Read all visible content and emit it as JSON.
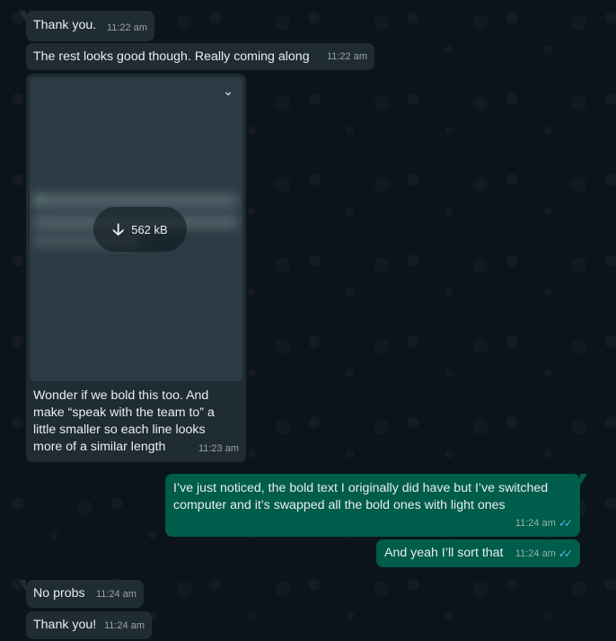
{
  "messages": [
    {
      "text": "Thank you.",
      "time": "11:22 am"
    },
    {
      "text": "The rest looks good though. Really coming along",
      "time": "11:22 am"
    },
    {
      "size": "562 kB",
      "caption": "Wonder if we bold this too. And make “speak with the team to” a little smaller so each line looks more of a similar length",
      "time": "11:23 am"
    },
    {
      "text": "I’ve just noticed, the bold text I originally did have but I’ve switched computer and it’s swapped all the bold ones with light ones",
      "time": "11:24 am"
    },
    {
      "text": "And yeah I’ll sort that",
      "time": "11:24 am"
    },
    {
      "text": "No probs",
      "time": "11:24 am"
    },
    {
      "text": "Thank you!",
      "time": "11:24 am"
    }
  ],
  "icons": {
    "download": "download-arrow-icon",
    "chevron": "chevron-down-icon",
    "read_receipt": "double-check-icon"
  },
  "colors": {
    "incoming_bubble": "#202c33",
    "outgoing_bubble": "#005c4b",
    "read_tick": "#53bdeb"
  }
}
